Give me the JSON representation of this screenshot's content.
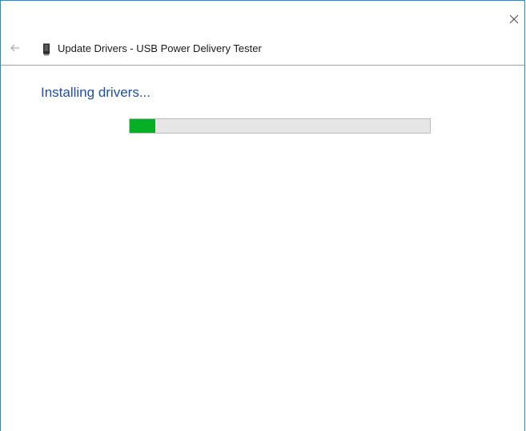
{
  "window": {
    "accent_color": "#1a8fd6"
  },
  "header": {
    "title": "Update Drivers - USB Power Delivery Tester",
    "back_icon": "back-arrow-icon",
    "device_icon": "device-icon",
    "close_icon": "close-icon"
  },
  "main": {
    "status_heading": "Installing drivers...",
    "status_color": "#1f4ea8",
    "progress": {
      "fraction": 0.085,
      "fill_color": "#06b025",
      "track_color": "#e6e6e6"
    }
  }
}
